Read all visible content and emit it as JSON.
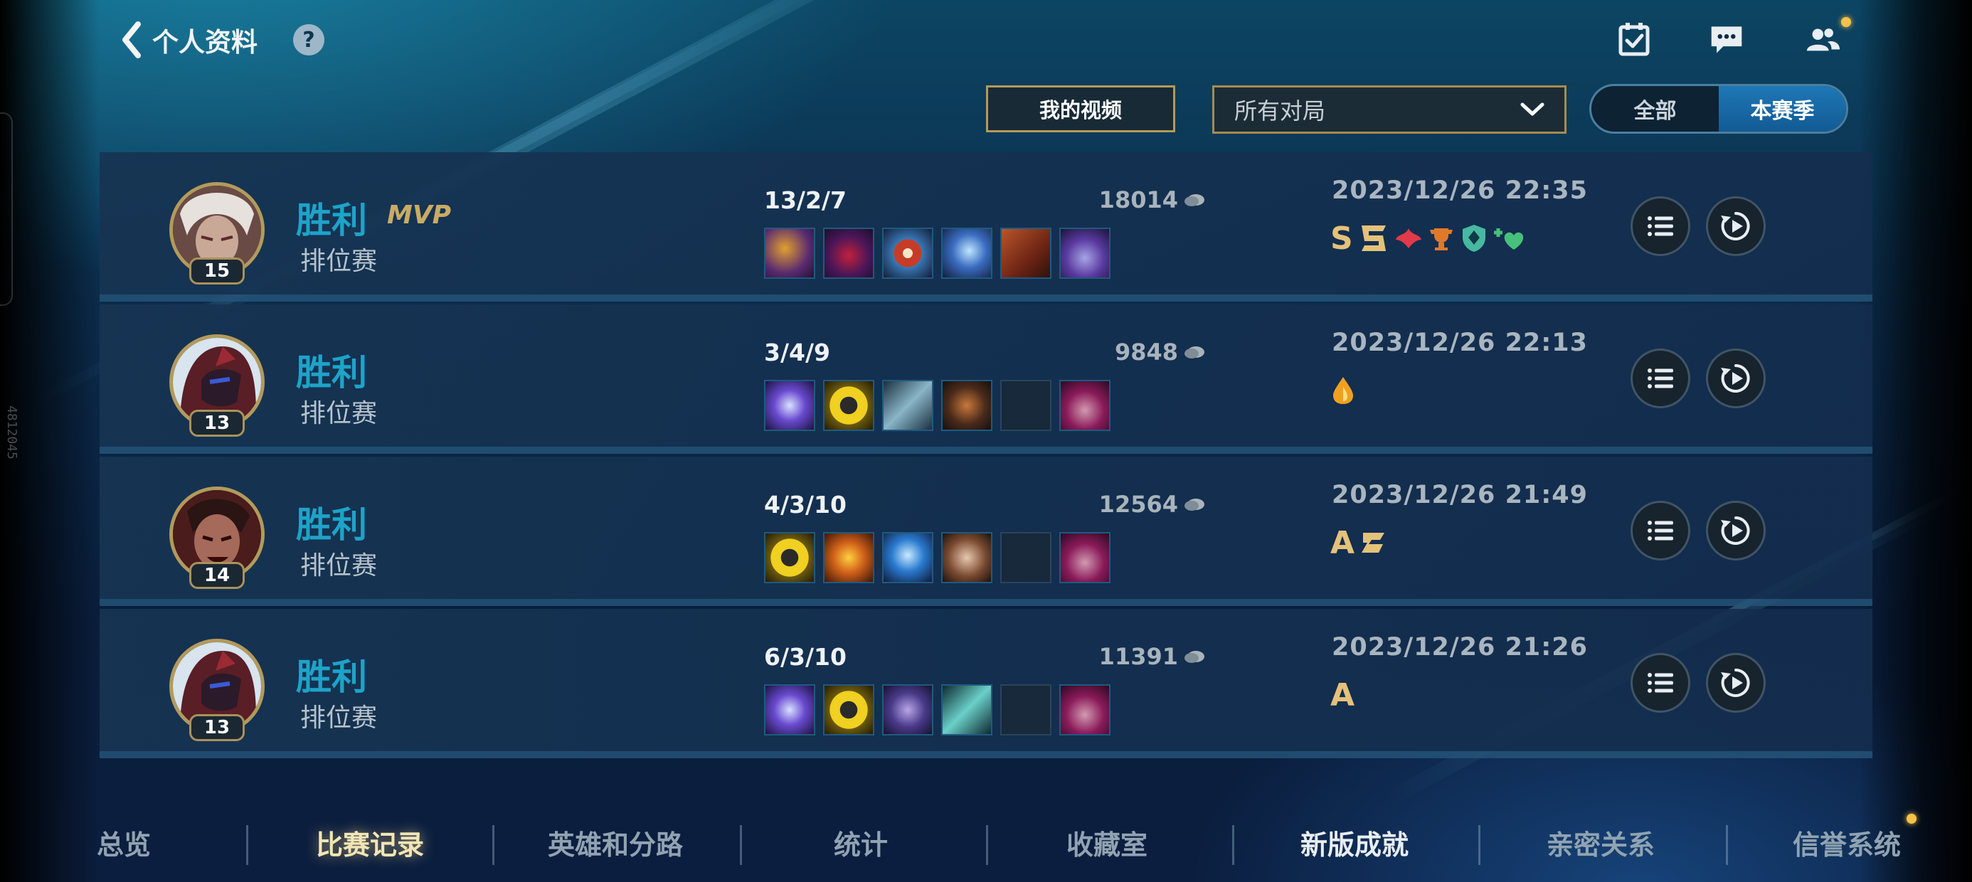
{
  "header": {
    "back_label": "个人资料",
    "help_symbol": "?",
    "icons": [
      "calendar-check-icon",
      "chat-icon",
      "friends-icon"
    ]
  },
  "filters": {
    "video_button": "我的视频",
    "match_type": "所有对局",
    "scope_tabs": [
      "全部",
      "本赛季"
    ],
    "active_scope": "本赛季"
  },
  "matches": [
    {
      "result": "胜利",
      "mvp": "MVP",
      "mode": "排位赛",
      "level": "15",
      "kda": "13/2/7",
      "gold": "18014",
      "date": "2023/12/26 22:35",
      "grade": "S",
      "badges": [
        "S",
        "penta-badge",
        "flame-wings-badge",
        "trophy-badge",
        "shield-badge",
        "heal-badge"
      ]
    },
    {
      "result": "胜利",
      "mvp": "",
      "mode": "排位赛",
      "level": "13",
      "kda": "3/4/9",
      "gold": "9848",
      "date": "2023/12/26 22:13",
      "grade": "",
      "badges": [
        "first-blood-drop-badge"
      ]
    },
    {
      "result": "胜利",
      "mvp": "",
      "mode": "排位赛",
      "level": "14",
      "kda": "4/3/10",
      "gold": "12564",
      "date": "2023/12/26 21:49",
      "grade": "A",
      "badges": [
        "A",
        "assist-badge"
      ]
    },
    {
      "result": "胜利",
      "mvp": "",
      "mode": "排位赛",
      "level": "13",
      "kda": "6/3/10",
      "gold": "11391",
      "date": "2023/12/26 21:26",
      "grade": "A",
      "badges": [
        "A"
      ]
    }
  ],
  "nav": {
    "items": [
      "总览",
      "比赛记录",
      "英雄和分路",
      "统计",
      "收藏室",
      "新版成就",
      "亲密关系",
      "信誉系统"
    ],
    "active": "比赛记录"
  },
  "side_text": "4812045"
}
